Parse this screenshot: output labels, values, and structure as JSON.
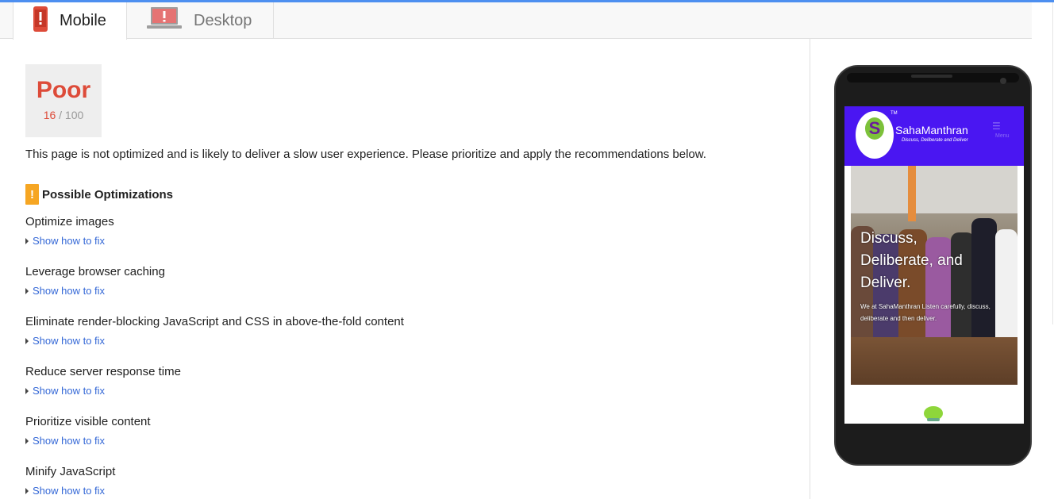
{
  "tabs": [
    {
      "label": "Mobile",
      "icon": "mobile-phone-icon",
      "active": true
    },
    {
      "label": "Desktop",
      "icon": "desktop-monitor-icon",
      "active": false
    }
  ],
  "score": {
    "label": "Poor",
    "value": "16",
    "max": "/ 100",
    "color": "#dd4b39",
    "fraction": 0.16
  },
  "summary": "This page is not optimized and is likely to deliver a slow user experience. Please prioritize and apply the recommendations below.",
  "optimizations": {
    "heading": "Possible Optimizations",
    "badge": "!",
    "rules": [
      {
        "title": "Optimize images",
        "link": "Show how to fix"
      },
      {
        "title": "Leverage browser caching",
        "link": "Show how to fix"
      },
      {
        "title": "Eliminate render-blocking JavaScript and CSS in above-the-fold content",
        "link": "Show how to fix"
      },
      {
        "title": "Reduce server response time",
        "link": "Show how to fix"
      },
      {
        "title": "Prioritize visible content",
        "link": "Show how to fix"
      },
      {
        "title": "Minify JavaScript",
        "link": "Show how to fix"
      }
    ]
  },
  "preview": {
    "site_name": "SahaManthran",
    "tagline": "Discuss, Deliberate and Deliver",
    "tm": "TM",
    "logo_letter": "S",
    "menu_label": "Menu",
    "hero_lines": [
      "Discuss,",
      "Deliberate, and",
      "Deliver."
    ],
    "hero_sub": "We at SahaManthran Listen carefully, discuss, deliberate and then deliver.",
    "header_color": "#4a16f2"
  }
}
